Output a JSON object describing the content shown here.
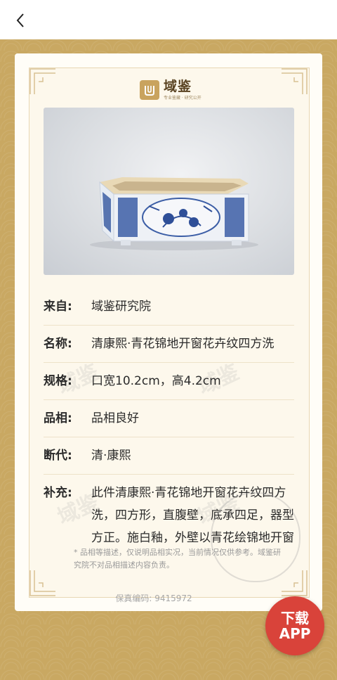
{
  "brand": {
    "name": "域鉴",
    "tagline": "专业鉴藏 · 研究公开"
  },
  "details": [
    {
      "label": "来自:",
      "value": "域鉴研究院"
    },
    {
      "label": "名称:",
      "value": "清康熙·青花锦地开窗花卉纹四方洗"
    },
    {
      "label": "规格:",
      "value": "口宽10.2cm，高4.2cm"
    },
    {
      "label": "品相:",
      "value": "品相良好"
    },
    {
      "label": "断代:",
      "value": "清·康熙"
    },
    {
      "label": "补充:",
      "value": "此件清康熙·青花锦地开窗花卉纹四方洗，四方形，直腹壁，底承四足，器型方正。施白釉，外壁以青花绘锦地开窗花卉纹，题材"
    }
  ],
  "disclaimer": "* 品相等描述，仅说明品相实况，当前情况仅供参考。域鉴研究院不对品相描述内容负责。",
  "serial": {
    "label": "保真编码:",
    "value": "9415972"
  },
  "download_button": {
    "line1": "下载",
    "line2": "APP"
  },
  "watermark_text": "域鉴"
}
